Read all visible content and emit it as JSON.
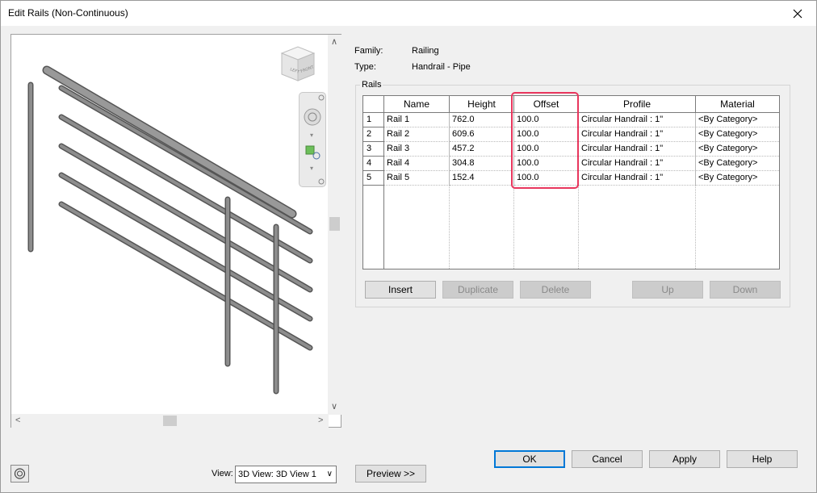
{
  "window": {
    "title": "Edit Rails (Non-Continuous)"
  },
  "info": {
    "family_label": "Family:",
    "family_value": "Railing",
    "type_label": "Type:",
    "type_value": "Handrail - Pipe",
    "group_label": "Rails"
  },
  "table": {
    "columns": [
      "Name",
      "Height",
      "Offset",
      "Profile",
      "Material"
    ],
    "rows": [
      {
        "num": "1",
        "name": "Rail 1",
        "height": "762.0",
        "offset": "100.0",
        "profile": "Circular Handrail : 1\"",
        "material": "<By Category>"
      },
      {
        "num": "2",
        "name": "Rail 2",
        "height": "609.6",
        "offset": "100.0",
        "profile": "Circular Handrail : 1\"",
        "material": "<By Category>"
      },
      {
        "num": "3",
        "name": "Rail 3",
        "height": "457.2",
        "offset": "100.0",
        "profile": "Circular Handrail : 1\"",
        "material": "<By Category>"
      },
      {
        "num": "4",
        "name": "Rail 4",
        "height": "304.8",
        "offset": "100.0",
        "profile": "Circular Handrail : 1\"",
        "material": "<By Category>"
      },
      {
        "num": "5",
        "name": "Rail 5",
        "height": "152.4",
        "offset": "100.0",
        "profile": "Circular Handrail : 1\"",
        "material": "<By Category>"
      }
    ]
  },
  "table_buttons": {
    "insert": "Insert",
    "duplicate": "Duplicate",
    "delete": "Delete",
    "up": "Up",
    "down": "Down"
  },
  "preview": {
    "view_label": "View:",
    "view_value": "3D View: 3D View 1",
    "preview_button": "Preview >>",
    "cube_left": "LEFT",
    "cube_front": "FRONT"
  },
  "footer": {
    "ok": "OK",
    "cancel": "Cancel",
    "apply": "Apply",
    "help": "Help"
  },
  "colors": {
    "highlight": "#e8365d",
    "rail": "#7d7d7d"
  },
  "icons": [
    "close-icon",
    "steering-wheel-icon",
    "zoom-icon",
    "orbit-icon"
  ]
}
